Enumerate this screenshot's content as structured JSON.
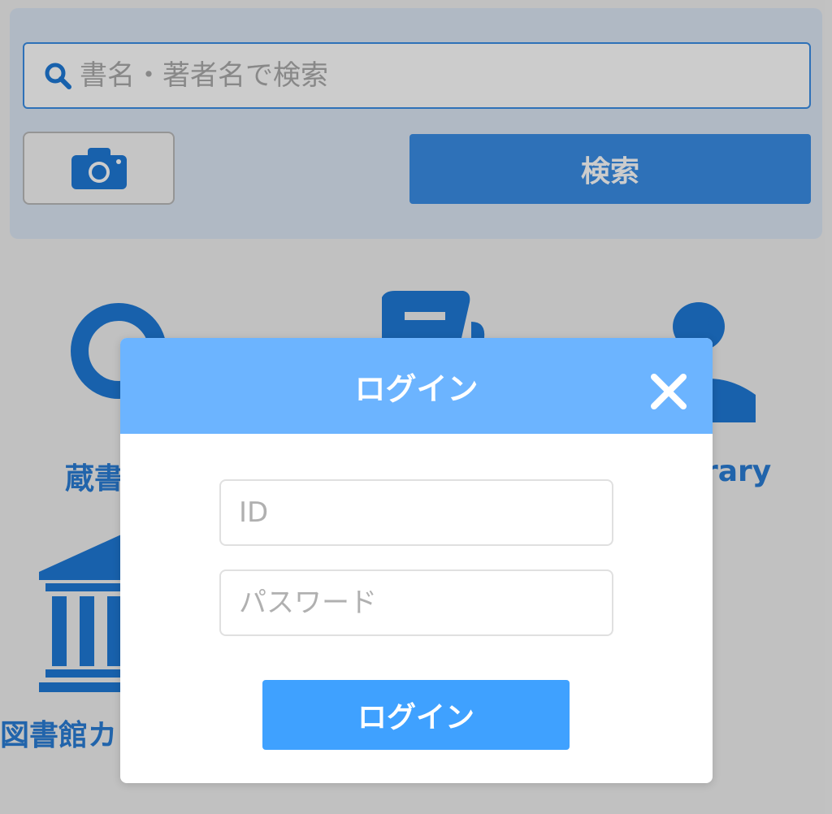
{
  "search": {
    "placeholder": "書名・著者名で検索",
    "button_label": "検索"
  },
  "menu": {
    "items": [
      {
        "label": "蔵書",
        "icon": "search-icon"
      },
      {
        "label": "",
        "icon": "book-icon"
      },
      {
        "label": "rary",
        "icon": "user-icon"
      },
      {
        "label": "図書館カ",
        "icon": "library-building-icon"
      }
    ]
  },
  "login_modal": {
    "title": "ログイン",
    "id_placeholder": "ID",
    "password_placeholder": "パスワード",
    "submit_label": "ログイン"
  },
  "colors": {
    "accent": "#3a8ee6",
    "modal_header": "#6cb4ff",
    "login_button": "#3fa1ff",
    "icon_blue": "#1f7ad7"
  }
}
